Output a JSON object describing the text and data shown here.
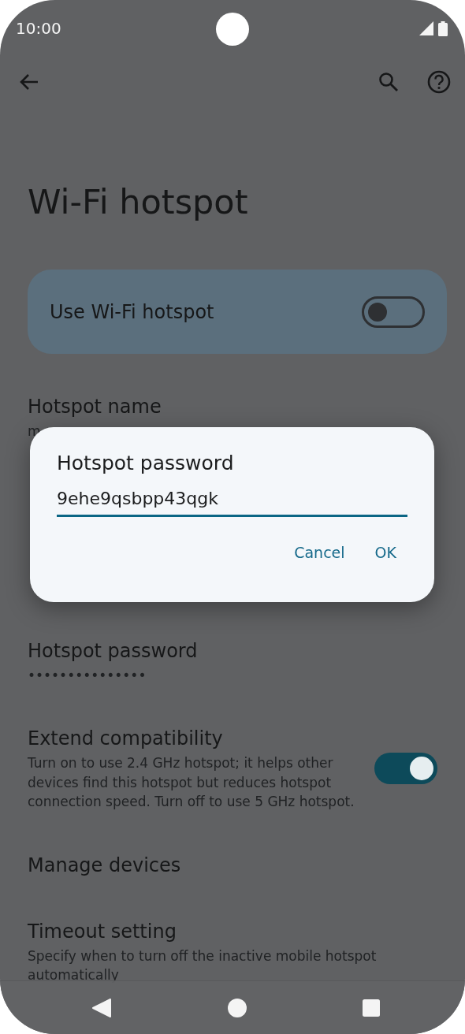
{
  "status_bar": {
    "time": "10:00"
  },
  "title": "Wi-Fi hotspot",
  "main_switch": {
    "label": "Use Wi-Fi hotspot",
    "on": false
  },
  "settings": [
    {
      "kind": "text",
      "title": "Hotspot name",
      "subtitle": "m"
    },
    {
      "kind": "text",
      "title": "Hotspot password",
      "subtitle": "•••••••••••••••"
    },
    {
      "kind": "switch",
      "title": "Extend compatibility",
      "subtitle": "Turn on to use 2.4 GHz hotspot; it helps other devices find this hotspot but reduces hotspot connection speed. Turn off to use 5 GHz hotspot.",
      "on": true
    },
    {
      "kind": "text",
      "title": "Manage devices"
    },
    {
      "kind": "text",
      "title": "Timeout setting",
      "subtitle": "Specify when to turn off the inactive mobile hotspot automatically"
    }
  ],
  "dialog": {
    "title": "Hotspot password",
    "value": "9ehe9qsbpp43qgk",
    "buttons": [
      "Cancel",
      "OK"
    ]
  }
}
